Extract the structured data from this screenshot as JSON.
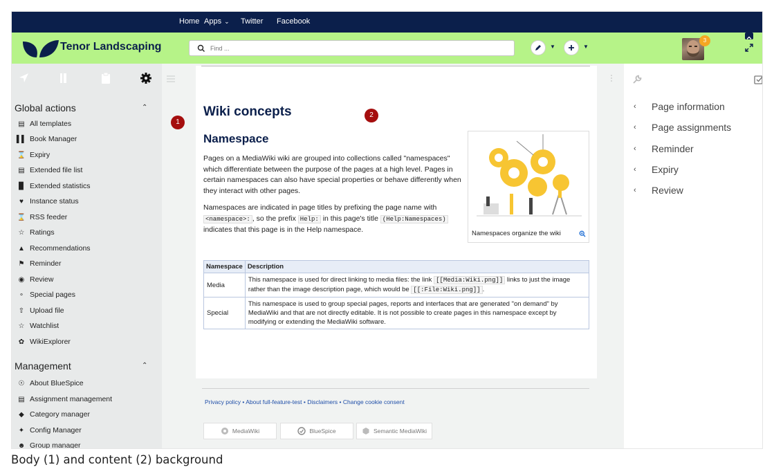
{
  "topnav": {
    "items": [
      "Home",
      "Apps",
      "Twitter",
      "Facebook"
    ]
  },
  "header": {
    "site_name": "Tenor Landscaping",
    "search_placeholder": "Find ...",
    "notification_count": "3",
    "brand_color": "#b6f388",
    "nav_color": "#0b1f4b"
  },
  "left_sidebar": {
    "tabs": [
      "navigation-icon",
      "book-icon",
      "clipboard-icon",
      "gear-icon"
    ],
    "sections": [
      {
        "title": "Global actions",
        "items": [
          {
            "label": "All templates",
            "icon": "template-icon"
          },
          {
            "label": "Book Manager",
            "icon": "books-icon"
          },
          {
            "label": "Expiry",
            "icon": "hourglass-icon"
          },
          {
            "label": "Extended file list",
            "icon": "file-list-icon"
          },
          {
            "label": "Extended statistics",
            "icon": "bar-chart-icon"
          },
          {
            "label": "Instance status",
            "icon": "heart-icon"
          },
          {
            "label": "RSS feeder",
            "icon": "rss-icon"
          },
          {
            "label": "Ratings",
            "icon": "star-icon"
          },
          {
            "label": "Recommendations",
            "icon": "flame-icon"
          },
          {
            "label": "Reminder",
            "icon": "flag-icon"
          },
          {
            "label": "Review",
            "icon": "eye-icon"
          },
          {
            "label": "Special pages",
            "icon": "special-icon"
          },
          {
            "label": "Upload file",
            "icon": "upload-icon"
          },
          {
            "label": "Watchlist",
            "icon": "star-outline-icon"
          },
          {
            "label": "WikiExplorer",
            "icon": "explorer-icon"
          }
        ]
      },
      {
        "title": "Management",
        "items": [
          {
            "label": "About BlueSpice",
            "icon": "info-icon"
          },
          {
            "label": "Assignment management",
            "icon": "assignment-icon"
          },
          {
            "label": "Category manager",
            "icon": "tag-icon"
          },
          {
            "label": "Config Manager",
            "icon": "wrench-icon"
          },
          {
            "label": "Group manager",
            "icon": "group-icon"
          }
        ]
      }
    ]
  },
  "markers": [
    "1",
    "2"
  ],
  "content": {
    "title": "Wiki concepts",
    "heading": "Namespace",
    "para1": "Pages on a MediaWiki wiki are grouped into collections called \"namespaces\" which differentiate between the purpose of the pages at a high level. Pages in certain namespaces can also have special properties or behave differently when they interact with other pages.",
    "para2_a": "Namespaces are indicated in page titles by prefixing the page name with",
    "para2_code1": "<namespace>:",
    "para2_b": ", so the prefix",
    "para2_code2": "Help:",
    "para2_c": "in this page's title",
    "para2_code3": "(Help:Namespaces)",
    "para2_d": "indicates that this page is in the Help namespace.",
    "figure_caption": "Namespaces organize the wiki",
    "table": {
      "headers": [
        "Namespace",
        "Description"
      ],
      "rows": [
        {
          "namespace": "Media",
          "desc_a": "This namespace is used for direct linking to media files: the link",
          "desc_code1": "[[Media:Wiki.png]]",
          "desc_b": "links to just the image rather than the image description page, which would be",
          "desc_code2": "[[:File:Wiki.png]]",
          "desc_c": "."
        },
        {
          "namespace": "Special",
          "desc": "This namespace is used to group special pages, reports and interfaces that are generated \"on demand\" by MediaWiki and that are not directly editable. It is not possible to create pages in this namespace except by modifying or extending the MediaWiki software."
        }
      ]
    }
  },
  "footer": {
    "links": [
      "Privacy policy",
      "About full-feature-test",
      "Disclaimers",
      "Change cookie consent"
    ],
    "separator": "•",
    "badges": [
      "MediaWiki",
      "BlueSpice",
      "Semantic MediaWiki"
    ]
  },
  "right_sidebar": {
    "items": [
      "Page information",
      "Page assignments",
      "Reminder",
      "Expiry",
      "Review"
    ]
  },
  "caption": "Body (1) and content (2) background"
}
